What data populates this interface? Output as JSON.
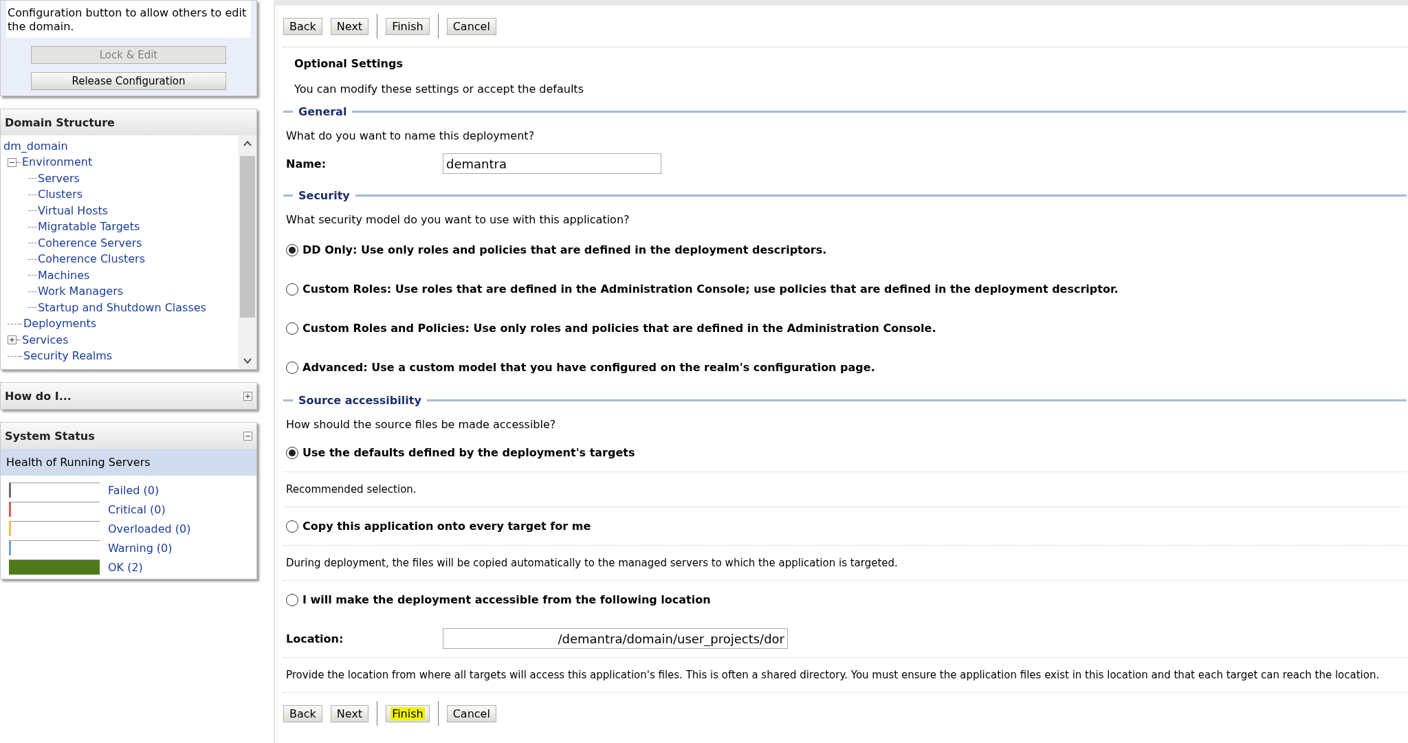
{
  "change_center": {
    "message": "Configuration button to allow others to edit the domain.",
    "buttons": [
      {
        "label": "Lock & Edit",
        "disabled": true
      },
      {
        "label": "Release Configuration",
        "disabled": false
      }
    ]
  },
  "domain_structure": {
    "title": "Domain Structure",
    "root": "dm_domain",
    "children": [
      {
        "label": "Environment",
        "expanded": true,
        "children": [
          {
            "label": "Servers"
          },
          {
            "label": "Clusters"
          },
          {
            "label": "Virtual Hosts"
          },
          {
            "label": "Migratable Targets"
          },
          {
            "label": "Coherence Servers"
          },
          {
            "label": "Coherence Clusters"
          },
          {
            "label": "Machines"
          },
          {
            "label": "Work Managers"
          },
          {
            "label": "Startup and Shutdown Classes"
          }
        ]
      },
      {
        "label": "Deployments"
      },
      {
        "label": "Services",
        "expanded": false
      },
      {
        "label": "Security Realms"
      }
    ]
  },
  "how_do_i": {
    "title": "How do I...",
    "expanded": false
  },
  "system_status": {
    "title": "System Status",
    "expanded": true,
    "subtitle": "Health of Running Servers",
    "rows": [
      {
        "label": "Failed (0)",
        "color": "#6b6b6b",
        "level": 0
      },
      {
        "label": "Critical (0)",
        "color": "#e05555",
        "level": 0
      },
      {
        "label": "Overloaded (0)",
        "color": "#f0c040",
        "level": 0
      },
      {
        "label": "Warning (0)",
        "color": "#6aa8c8",
        "level": 0
      },
      {
        "label": "OK (2)",
        "color": "#4e7a1a",
        "level": 1
      }
    ]
  },
  "top_buttons": [
    {
      "label": "Back",
      "highlighted": false
    },
    {
      "label": "Next",
      "highlighted": false
    },
    {
      "label": "Finish",
      "highlighted": false
    },
    {
      "label": "Cancel",
      "highlighted": false
    }
  ],
  "title": "Optional Settings",
  "intro": "You can modify these settings or accept the defaults",
  "general": {
    "heading": "General",
    "question": "What do you want to name this deployment?",
    "name_label": "Name:",
    "name_value": "demantra"
  },
  "security": {
    "heading": "Security",
    "question": "What security model do you want to use with this application?",
    "options": [
      {
        "label": "DD Only: Use only roles and policies that are defined in the deployment descriptors.",
        "selected": true
      },
      {
        "label": "Custom Roles: Use roles that are defined in the Administration Console; use policies that are defined in the deployment descriptor.",
        "selected": false
      },
      {
        "label": "Custom Roles and Policies: Use only roles and policies that are defined in the Administration Console.",
        "selected": false
      },
      {
        "label": "Advanced: Use a custom model that you have configured on the realm's configuration page.",
        "selected": false
      }
    ]
  },
  "source_accessibility": {
    "heading": "Source accessibility",
    "question": "How should the source files be made accessible?",
    "options": [
      {
        "label": "Use the defaults defined by the deployment's targets",
        "selected": true,
        "note": "Recommended selection."
      },
      {
        "label": "Copy this application onto every target for me",
        "selected": false,
        "note": "During deployment, the files will be copied automatically to the managed servers to which the application is targeted."
      },
      {
        "label": "I will make the deployment accessible from the following location",
        "selected": false,
        "location_label": "Location:",
        "location_value": "/demantra/domain/user_projects/dor",
        "note": "Provide the location from where all targets will access this application's files. This is often a shared directory. You must ensure the application files exist in this location and that each target can reach the location."
      }
    ]
  },
  "bottom_buttons": [
    {
      "label": "Back",
      "highlighted": false
    },
    {
      "label": "Next",
      "highlighted": false
    },
    {
      "label": "Finish",
      "highlighted": true
    },
    {
      "label": "Cancel",
      "highlighted": false
    }
  ]
}
